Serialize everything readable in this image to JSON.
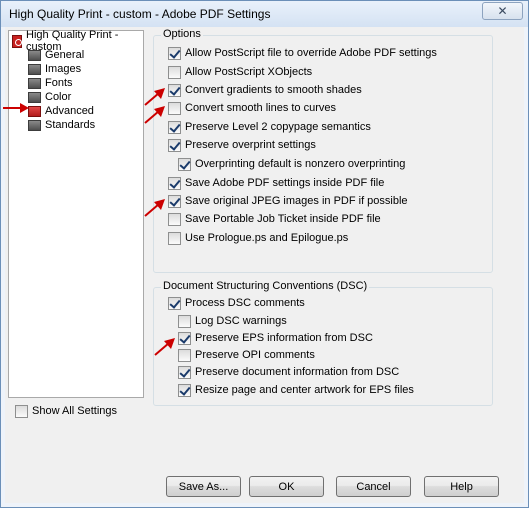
{
  "window": {
    "title": "High Quality Print - custom - Adobe PDF Settings",
    "close_symbol": "✕"
  },
  "tree": {
    "root": "High Quality Print - custom",
    "items": [
      {
        "label": "General",
        "selected": false
      },
      {
        "label": "Images",
        "selected": false
      },
      {
        "label": "Fonts",
        "selected": false
      },
      {
        "label": "Color",
        "selected": false
      },
      {
        "label": "Advanced",
        "selected": true
      },
      {
        "label": "Standards",
        "selected": false
      }
    ]
  },
  "options": {
    "legend": "Options",
    "items": [
      {
        "label": "Allow PostScript file to override Adobe PDF settings",
        "checked": true
      },
      {
        "label": "Allow PostScript XObjects",
        "checked": false
      },
      {
        "label": "Convert gradients to smooth shades",
        "checked": true
      },
      {
        "label": "Convert smooth lines to curves",
        "checked": false
      },
      {
        "label": "Preserve Level 2 copypage semantics",
        "checked": true
      },
      {
        "label": "Preserve overprint settings",
        "checked": true
      },
      {
        "label": "Overprinting default is nonzero overprinting",
        "checked": true
      },
      {
        "label": "Save Adobe PDF settings inside PDF file",
        "checked": true
      },
      {
        "label": "Save original JPEG images in PDF if possible",
        "checked": true
      },
      {
        "label": "Save Portable Job Ticket inside PDF file",
        "checked": false
      },
      {
        "label": "Use Prologue.ps and Epilogue.ps",
        "checked": false
      }
    ]
  },
  "dsc": {
    "legend": "Document Structuring Conventions (DSC)",
    "items": [
      {
        "label": "Process DSC comments",
        "checked": true
      },
      {
        "label": "Log DSC warnings",
        "checked": false
      },
      {
        "label": "Preserve EPS information from DSC",
        "checked": true
      },
      {
        "label": "Preserve OPI comments",
        "checked": false
      },
      {
        "label": "Preserve document information from DSC",
        "checked": true
      },
      {
        "label": "Resize page and center artwork for EPS files",
        "checked": true
      }
    ]
  },
  "show_all": {
    "label": "Show All Settings",
    "checked": false
  },
  "buttons": {
    "save_as": "Save As...",
    "ok": "OK",
    "cancel": "Cancel",
    "help": "Help"
  },
  "colors": {
    "annotation_arrow": "#cc0000",
    "accent_check": "#1b3b6b"
  }
}
